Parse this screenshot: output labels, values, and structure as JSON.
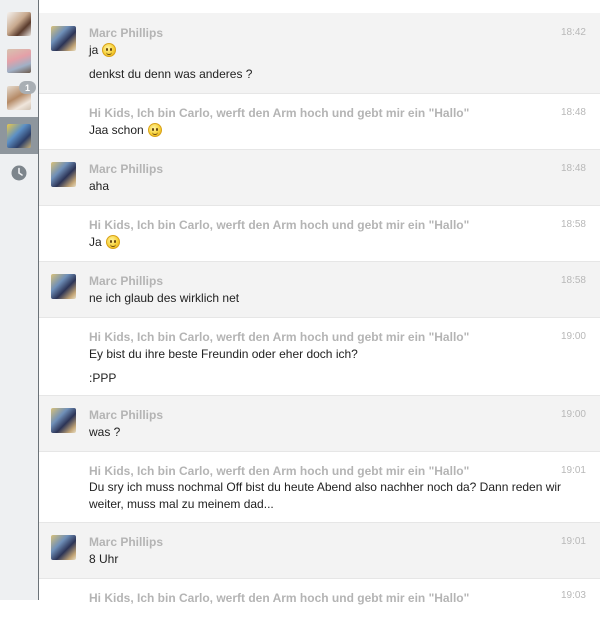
{
  "sidebar": {
    "items": [
      {
        "name": "contact-avatar-1",
        "active": false
      },
      {
        "name": "contact-avatar-2",
        "active": false
      },
      {
        "name": "contact-avatar-3",
        "active": false,
        "badge": "1"
      },
      {
        "name": "contact-avatar-4",
        "active": true
      }
    ],
    "clock_icon": "clock-icon"
  },
  "messages": [
    {
      "sender": "Marc Phillips",
      "time": "18:42",
      "lines": [
        "ja",
        "denkst du denn was anderes ?"
      ],
      "emoji": "rolling-eyes-emoji"
    },
    {
      "sender": "Hi Kids, Ich bin Carlo, werft den Arm hoch und gebt mir ein \"Hallo\"",
      "time": "18:48",
      "lines": [
        "Jaa schon"
      ],
      "emoji": "wink-emoji"
    },
    {
      "sender": "Marc Phillips",
      "time": "18:48",
      "lines": [
        "aha"
      ]
    },
    {
      "sender": "Hi Kids, Ich bin Carlo, werft den Arm hoch und gebt mir ein \"Hallo\"",
      "time": "18:58",
      "lines": [
        "Ja"
      ],
      "emoji": "wink-emoji"
    },
    {
      "sender": "Marc Phillips",
      "time": "18:58",
      "lines": [
        "ne ich glaub des wirklich net"
      ]
    },
    {
      "sender": "Hi Kids, Ich bin Carlo, werft den Arm hoch und gebt mir ein \"Hallo\"",
      "time": "19:00",
      "lines": [
        "Ey bist du ihre beste Freundin oder eher doch ich?",
        ":PPP"
      ]
    },
    {
      "sender": "Marc Phillips",
      "time": "19:00",
      "lines": [
        "was ?"
      ]
    },
    {
      "sender": "Hi Kids, Ich bin Carlo, werft den Arm hoch und gebt mir ein \"Hallo\"",
      "time": "19:01",
      "lines": [
        "Du sry ich muss nochmal Off bist du heute Abend also nachher noch da? Dann reden wir weiter, muss mal zu meinem dad..."
      ]
    },
    {
      "sender": "Marc Phillips",
      "time": "19:01",
      "lines": [
        "8 Uhr"
      ]
    },
    {
      "sender": "Hi Kids, Ich bin Carlo, werft den Arm hoch und gebt mir ein \"Hallo\"",
      "time": "19:03",
      "lines": []
    }
  ]
}
